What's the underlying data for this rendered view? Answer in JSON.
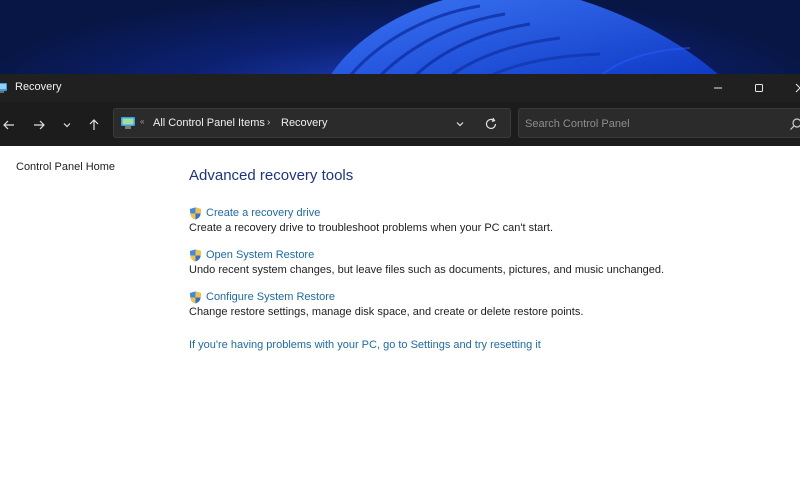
{
  "window": {
    "title": "Recovery",
    "app_icon": "control-panel-icon"
  },
  "address_bar": {
    "path_separator": "«",
    "breadcrumb": [
      "All Control Panel Items",
      "Recovery"
    ],
    "crumb_arrow": "›",
    "search_placeholder": "Search Control Panel"
  },
  "sidebar": {
    "home_link": "Control Panel Home"
  },
  "main": {
    "heading": "Advanced recovery tools",
    "tasks": [
      {
        "label": "Create a recovery drive",
        "description": "Create a recovery drive to troubleshoot problems when your PC can't start.",
        "icon": "uac-shield-icon"
      },
      {
        "label": "Open System Restore",
        "description": "Undo recent system changes, but leave files such as documents, pictures, and music unchanged.",
        "icon": "uac-shield-icon"
      },
      {
        "label": "Configure System Restore",
        "description": "Change restore settings, manage disk space, and create or delete restore points.",
        "icon": "uac-shield-icon"
      }
    ],
    "reset_link": "If you're having problems with your PC, go to Settings and try resetting it"
  },
  "colors": {
    "titlebar_bg": "#202020",
    "link": "#1e6aa8",
    "heading": "#1e3287",
    "wallpaper_accent": "#1d4fd8"
  }
}
